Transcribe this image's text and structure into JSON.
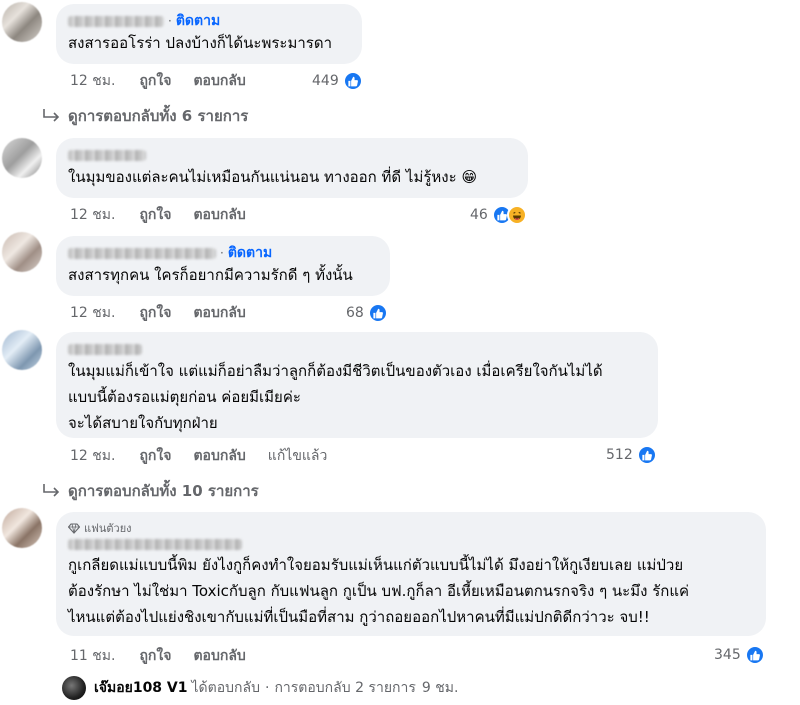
{
  "comments": [
    {
      "text_lines": [
        "สงสารออโรร่า ปลงบ้างก็ได้นะพระมารดา"
      ],
      "follow_label": "ติดตาม",
      "time": "12 ชม.",
      "like_label": "ถูกใจ",
      "reply_label": "ตอบกลับ",
      "reaction_count": "449",
      "view_replies": "ดูการตอบกลับทั้ง 6 รายการ"
    },
    {
      "text_lines": [
        "ในมุมของแต่ละคนไม่เหมือนกันแน่นอน ทางออก ที่ดี ไม่รู้หงะ 😁"
      ],
      "time": "12 ชม.",
      "like_label": "ถูกใจ",
      "reply_label": "ตอบกลับ",
      "reaction_count": "46"
    },
    {
      "text_lines": [
        "สงสารทุกคน ใครก็อยากมีความรักดี ๆ ทั้งนั้น"
      ],
      "follow_label": "ติดตาม",
      "time": "12 ชม.",
      "like_label": "ถูกใจ",
      "reply_label": "ตอบกลับ",
      "reaction_count": "68"
    },
    {
      "text_lines": [
        "ในมุมแม่ก็เข้าใจ แต่แม่ก็อย่าลืมว่าลูกก็ต้องมีชีวิตเป็นของตัวเอง เมื่อเครียใจกันไม่ได้",
        "แบบนี้ต้องรอแม่ตุยก่อน ค่อยมีเมียค่ะ",
        "จะได้สบายใจกับทุกฝ่าย"
      ],
      "time": "12 ชม.",
      "like_label": "ถูกใจ",
      "reply_label": "ตอบกลับ",
      "edited_label": "แก้ไขแล้ว",
      "reaction_count": "512",
      "view_replies": "ดูการตอบกลับทั้ง 10 รายการ"
    },
    {
      "badge": "แฟนตัวยง",
      "text_lines": [
        "กูเกลียดแม่แบบนี้พิม ยังไงกูก็คงทำใจยอมรับแม่เห็นแก่ตัวแบบนี้ไม่ได้ มึงอย่าให้กูเงียบเลย แม่ป่วย",
        "ต้องรักษา ไม่ใช่มา Toxicกับลูก กับแฟนลูก กูเป็น บฟ.กูก็ลา อีเหี้ยเหมือนตกนรกจริง ๆ นะมึง รักแค่",
        "ไหนแต่ต้องไปแย่งชิงเขากับแม่ที่เป็นมือที่สาม กูว่าถอยออกไปหาคนที่มีแม่ปกติดีกว่าวะ จบ!!"
      ],
      "time": "11 ชม.",
      "like_label": "ถูกใจ",
      "reply_label": "ตอบกลับ",
      "reaction_count": "345"
    }
  ],
  "reply_summary": {
    "actor": "เจ๊มอย108 V1",
    "action": "ได้ตอบกลับ",
    "separator": "·",
    "replies": "การตอบกลับ 2 รายการ",
    "time": "9 ชม."
  },
  "colors": {
    "bubble": "#f0f2f5",
    "link_blue": "#0866ff",
    "meta_gray": "#65676b",
    "like_blue": "#1877f2"
  },
  "icons": {
    "like": "thumbs-up-icon",
    "haha": "laughing-emoji-icon",
    "reply_arrow": "reply-arrow-icon",
    "badge": "diamond-icon"
  }
}
